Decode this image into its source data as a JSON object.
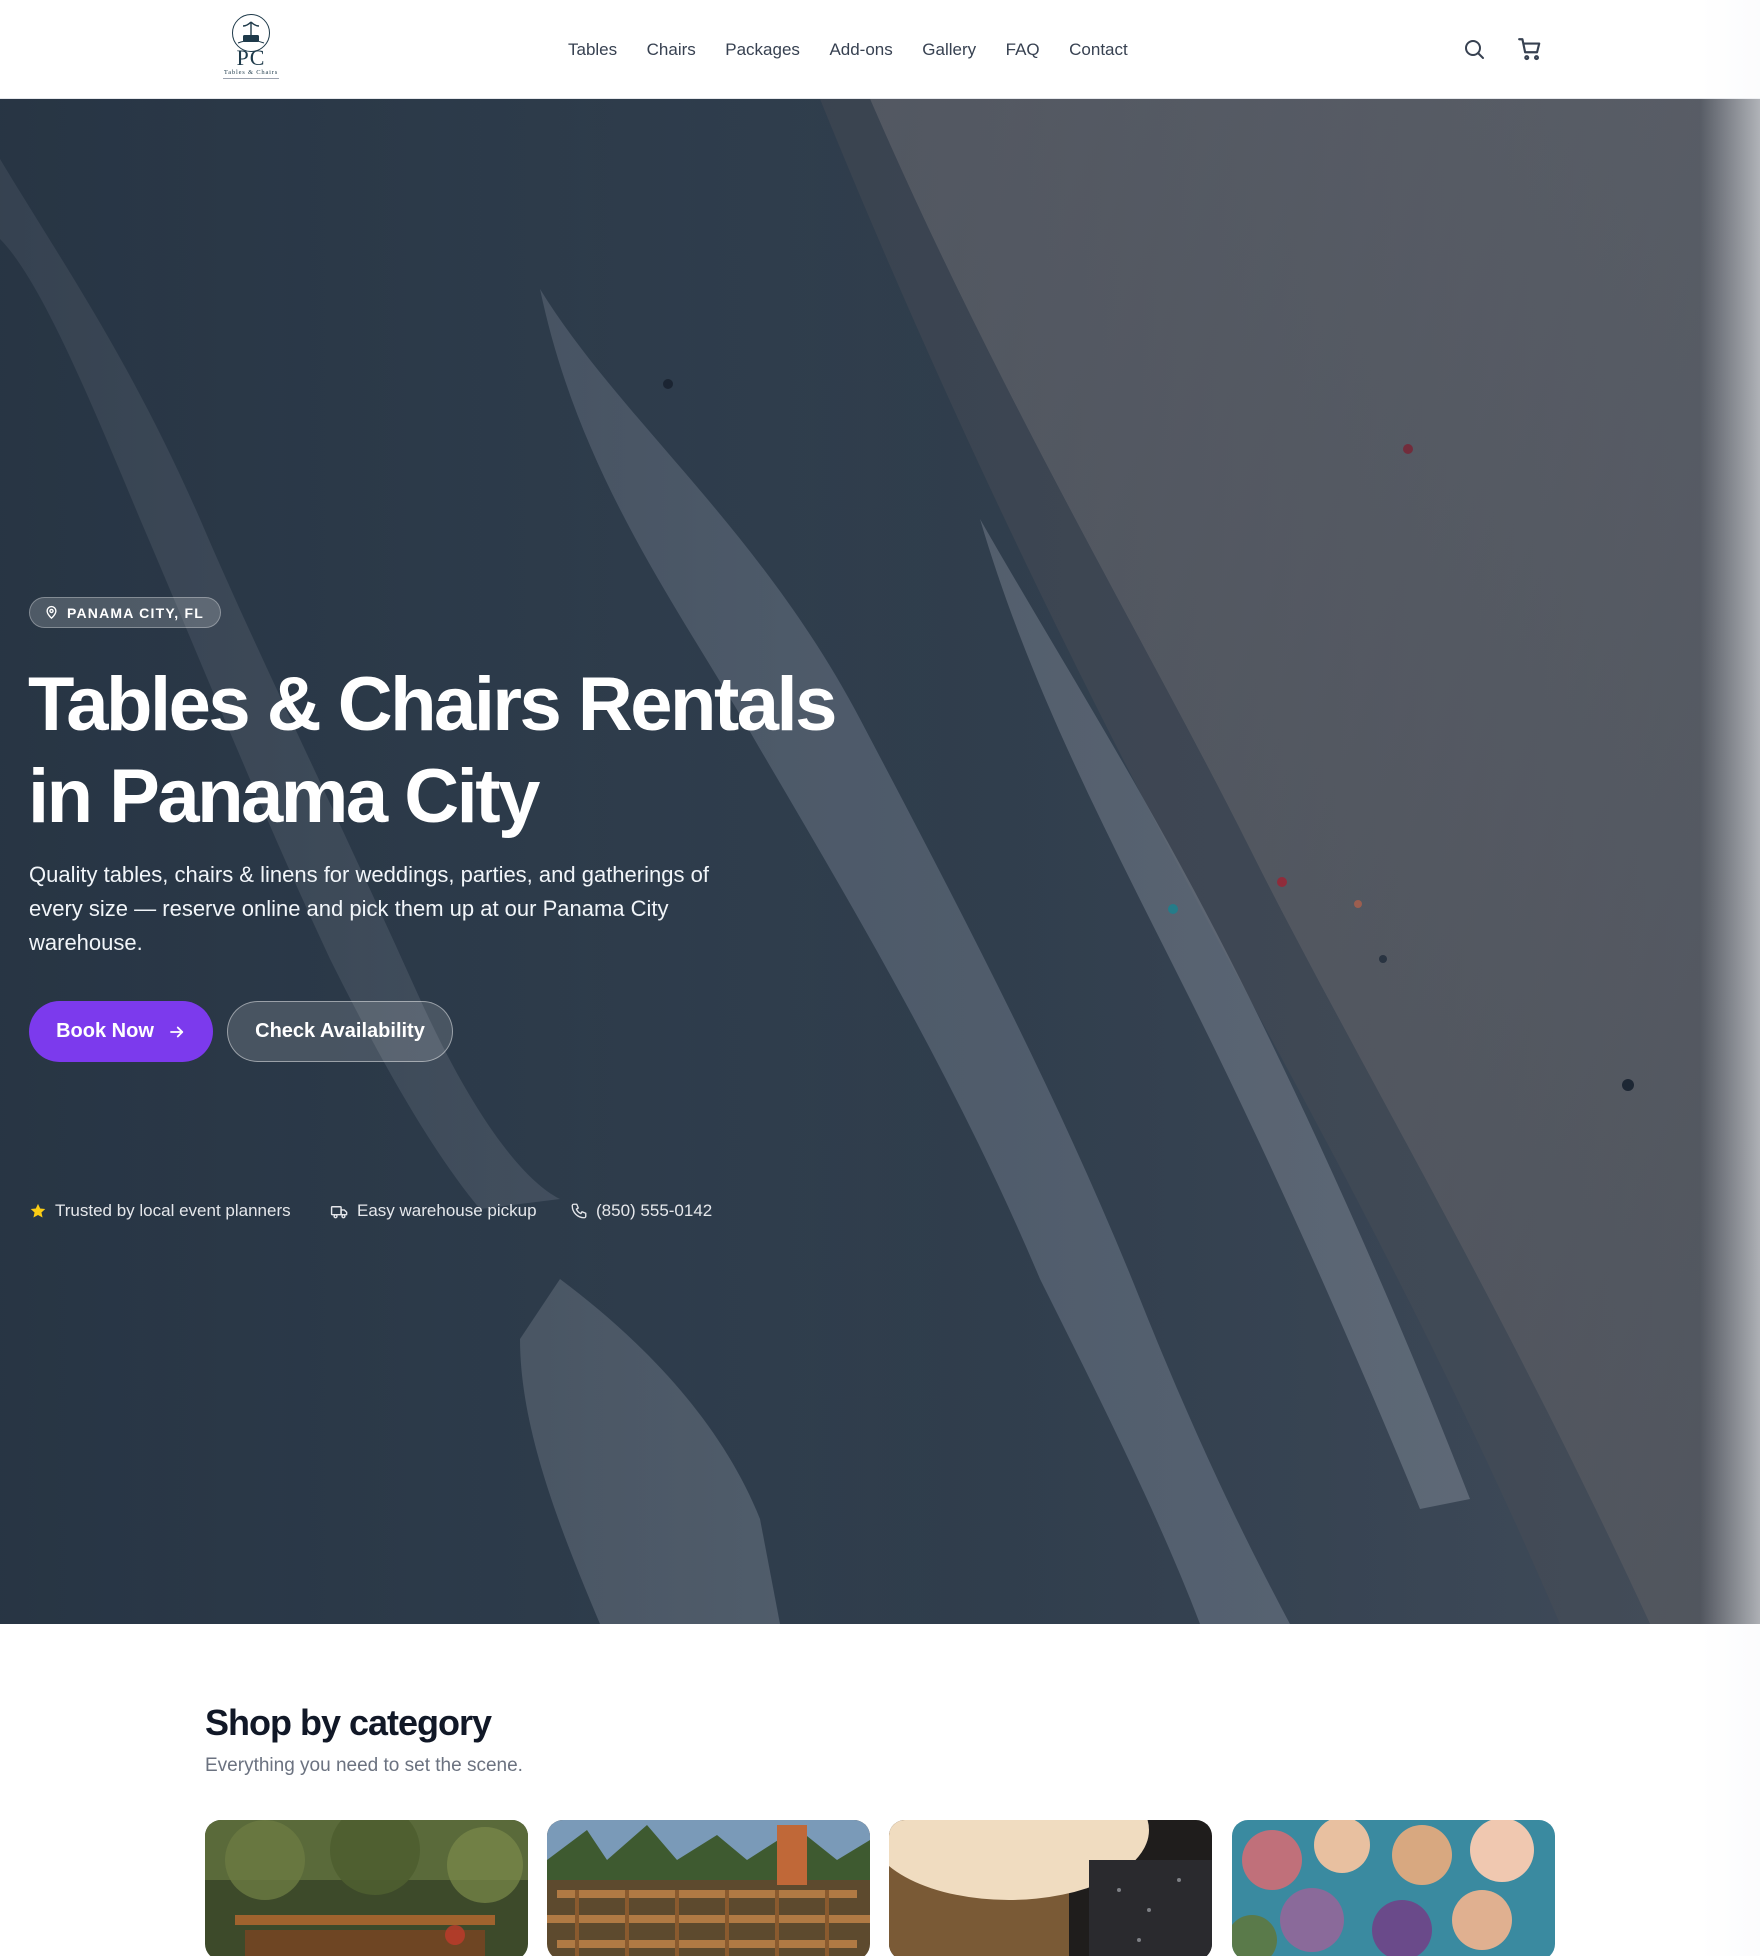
{
  "header": {
    "logo": {
      "monogram": "PC",
      "tagline": "Tables & Chairs"
    },
    "nav": [
      "Tables",
      "Chairs",
      "Packages",
      "Add-ons",
      "Gallery",
      "FAQ",
      "Contact"
    ],
    "icons": {
      "search": "search-icon",
      "cart": "cart-icon"
    }
  },
  "hero": {
    "location_badge": "PANAMA CITY, FL",
    "title_line1": "Tables & Chairs Rentals",
    "title_line2": "in Panama City",
    "subtitle": "Quality tables, chairs & linens for weddings, parties, and gatherings of every size — reserve online and pick them up at our Panama City warehouse.",
    "primary_cta": "Book Now",
    "secondary_cta": "Check Availability",
    "trust": [
      {
        "icon": "star-icon",
        "text": "Trusted by local event planners"
      },
      {
        "icon": "truck-icon",
        "text": "Easy warehouse pickup"
      },
      {
        "icon": "phone-icon",
        "text": "(850) 555-0142"
      }
    ]
  },
  "categories": {
    "title": "Shop by category",
    "subtitle": "Everything you need to set the scene."
  },
  "colors": {
    "accent": "#7c3aed",
    "star": "#facc15",
    "text_dark": "#111827",
    "text_muted": "#6b7280"
  }
}
